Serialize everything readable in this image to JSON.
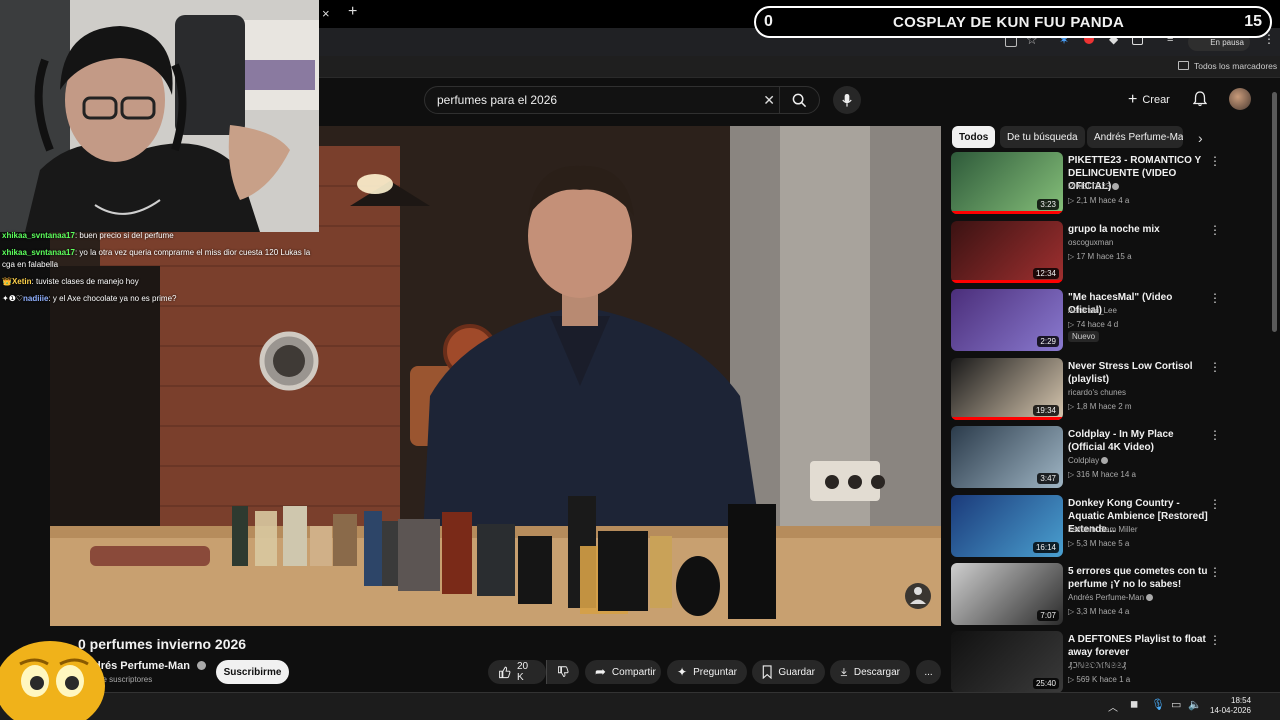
{
  "overlay": {
    "left": "0",
    "title": "COSPLAY DE KUN FUU PANDA",
    "right": "15"
  },
  "browser": {
    "close_tab": "×",
    "new_tab": "+",
    "paused": "En pausa",
    "bookmarks_label": "Todos los marcadores"
  },
  "youtube": {
    "search_value": "perfumes para el 2026",
    "create_label": "Crear",
    "chips": [
      "Todos",
      "De tu búsqueda",
      "Andrés Perfume-Man"
    ],
    "video_title": "0 perfumes invierno 2026",
    "channel": "drés Perfume-Man",
    "subs": "l de suscriptores",
    "subscribe": "Suscribirme",
    "likes": "20 K",
    "share": "Compartir",
    "ask": "Preguntar",
    "save": "Guardar",
    "download": "Descargar",
    "more": "..."
  },
  "recommendations": [
    {
      "title": "PIKETTE23 - ROMANTICO Y DELINCUENTE (VIDEO OFICIAL)",
      "channel": "PIKETTE23",
      "verified": true,
      "views": "2,1 M",
      "age": "hace 4 a",
      "duration": "3:23",
      "colors": [
        "#2e5a3a",
        "#86c07a"
      ],
      "badge": ""
    },
    {
      "title": "grupo la noche mix",
      "channel": "oscoguxman",
      "verified": false,
      "views": "17 M",
      "age": "hace 15 a",
      "duration": "12:34",
      "colors": [
        "#3a1212",
        "#a03030"
      ],
      "badge": ""
    },
    {
      "title": "\"Me hacesMal\" (Video Oficial)",
      "channel": "Aarónski_Lee",
      "verified": false,
      "views": "74",
      "age": "hace 4 d",
      "duration": "2:29",
      "colors": [
        "#4b2e7a",
        "#8a7ad0"
      ],
      "badge": "Nuevo"
    },
    {
      "title": "Never Stress Low Cortisol (playlist)",
      "channel": "ricardo's chunes",
      "verified": false,
      "views": "1,8 M",
      "age": "hace 2 m",
      "duration": "19:34",
      "colors": [
        "#1a1a1a",
        "#d8c8b0"
      ],
      "badge": ""
    },
    {
      "title": "Coldplay - In My Place (Official 4K Video)",
      "channel": "Coldplay",
      "verified": true,
      "views": "316 M",
      "age": "hace 14 a",
      "duration": "3:47",
      "colors": [
        "#2b3b4b",
        "#9fb5c4"
      ],
      "badge": ""
    },
    {
      "title": "Donkey Kong Country - Aquatic Ambience [Restored] Extende...",
      "channel": "Jammin' Sam Miller",
      "verified": false,
      "views": "5,3 M",
      "age": "hace 5 a",
      "duration": "16:14",
      "colors": [
        "#1b3a7a",
        "#4aa0d0"
      ],
      "badge": ""
    },
    {
      "title": "5 errores que cometes con tu perfume ¡Y no lo sabes!",
      "channel": "Andrés Perfume-Man",
      "verified": true,
      "views": "3,3 M",
      "age": "hace 4 a",
      "duration": "7:07",
      "colors": [
        "#cfcfcf",
        "#2b2b2b"
      ],
      "badge": ""
    },
    {
      "title": "A DEFTONES Playlist to float away forever",
      "channel": "₰ℑℕ𝔖𝔒ℳℕ𝔖𝔖₰",
      "verified": false,
      "views": "569 K",
      "age": "hace 1 a",
      "duration": "25:40",
      "colors": [
        "#111",
        "#3a3a3a"
      ],
      "badge": ""
    }
  ],
  "chat": [
    {
      "user": "xhikaa_svntanaa17",
      "text": "buen precio si del perfume",
      "color": "#5cff5c",
      "prefix": ""
    },
    {
      "user": "xhikaa_svntanaa17",
      "text": "yo la otra vez queria comprarme el miss dior cuesta 120 Lukas la cga en falabella",
      "color": "#5cff5c",
      "prefix": ""
    },
    {
      "user": "Xetin",
      "text": "tuviste clases de manejo hoy",
      "color": "#ffd24a",
      "prefix": "👑"
    },
    {
      "user": "nadiiie",
      "text": "y el Axe chocolate ya no es prime?",
      "color": "#8fb0ff",
      "prefix": "✦❶♡"
    }
  ],
  "taskbar": {
    "time": "18:54",
    "date": "14-04-2026"
  }
}
